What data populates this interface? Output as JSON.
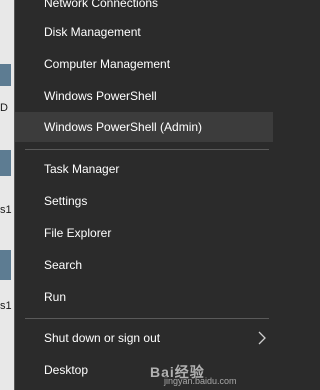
{
  "desktop": {
    "labels": [
      "D",
      "s1",
      "s1"
    ]
  },
  "menu": {
    "items": [
      {
        "label": "Network Connections"
      },
      {
        "label": "Disk Management"
      },
      {
        "label": "Computer Management"
      },
      {
        "label": "Windows PowerShell"
      },
      {
        "label": "Windows PowerShell (Admin)"
      },
      {
        "label": "Task Manager"
      },
      {
        "label": "Settings"
      },
      {
        "label": "File Explorer"
      },
      {
        "label": "Search"
      },
      {
        "label": "Run"
      },
      {
        "label": "Shut down or sign out"
      },
      {
        "label": "Desktop"
      }
    ],
    "submenu_icon": "chevron-right-icon",
    "hover_color": "#3c3c3c"
  },
  "watermark": {
    "logo": "Bai经验",
    "url": "jingyan.baidu.com"
  }
}
